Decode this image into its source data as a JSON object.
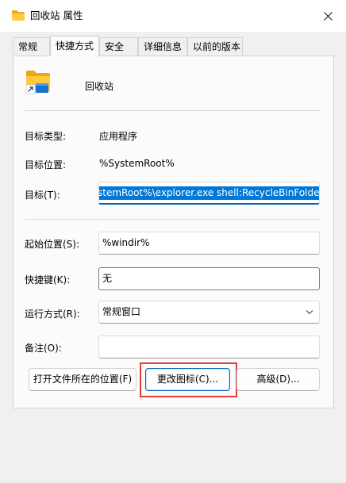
{
  "window": {
    "title": "回收站 属性"
  },
  "tabs": [
    {
      "label": "常规",
      "active": false
    },
    {
      "label": "快捷方式",
      "active": true
    },
    {
      "label": "安全",
      "active": false
    },
    {
      "label": "详细信息",
      "active": false
    },
    {
      "label": "以前的版本",
      "active": false
    }
  ],
  "shortcut": {
    "name": "回收站",
    "target_type_label": "目标类型:",
    "target_type_value": "应用程序",
    "target_location_label": "目标位置:",
    "target_location_value": "%SystemRoot%",
    "target_label": "目标(T):",
    "target_value": "stemRoot%\\explorer.exe shell:RecycleBinFolder",
    "start_in_label": "起始位置(S):",
    "start_in_value": "%windir%",
    "hotkey_label": "快捷键(K):",
    "hotkey_value": "无",
    "run_label": "运行方式(R):",
    "run_value": "常规窗口",
    "comment_label": "备注(O):",
    "comment_value": ""
  },
  "buttons": {
    "open_location": "打开文件所在的位置(F)",
    "change_icon": "更改图标(C)...",
    "advanced": "高级(D)..."
  },
  "colors": {
    "accent": "#0067c0",
    "selection": "#0078d7",
    "highlight": "#e23c3c"
  }
}
